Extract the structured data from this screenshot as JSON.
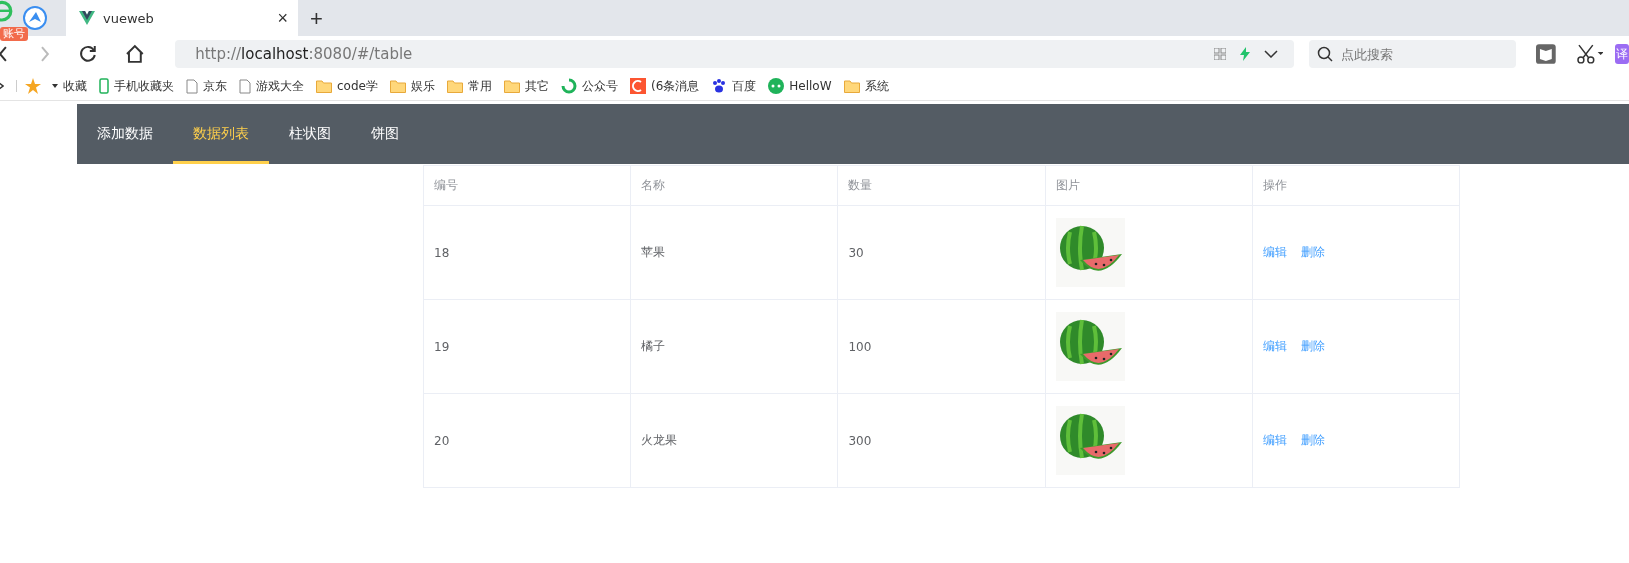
{
  "browser": {
    "badge": "账号",
    "tab": {
      "title": "vueweb",
      "close": "×"
    },
    "new_tab": "+",
    "address": "http://**localhost**:8080/#/table",
    "search": {
      "placeholder": "点此搜索"
    },
    "translate": "译"
  },
  "bookmarks": [
    {
      "label": "收藏",
      "kind": "star"
    },
    {
      "label": "手机收藏夹",
      "kind": "phone"
    },
    {
      "label": "京东",
      "kind": "page"
    },
    {
      "label": "游戏大全",
      "kind": "page"
    },
    {
      "label": "code学",
      "kind": "folder"
    },
    {
      "label": "娱乐",
      "kind": "folder"
    },
    {
      "label": "常用",
      "kind": "folder"
    },
    {
      "label": "其它",
      "kind": "folder"
    },
    {
      "label": "公众号",
      "kind": "swirl"
    },
    {
      "label": "(6条消息",
      "kind": "c"
    },
    {
      "label": "百度",
      "kind": "paw"
    },
    {
      "label": "HelloW",
      "kind": "chat"
    },
    {
      "label": "系统",
      "kind": "folder"
    }
  ],
  "nav": [
    {
      "label": "添加数据",
      "selected": false
    },
    {
      "label": "数据列表",
      "selected": true
    },
    {
      "label": "柱状图",
      "selected": false
    },
    {
      "label": "饼图",
      "selected": false
    }
  ],
  "table": {
    "columns": [
      "编号",
      "名称",
      "数量",
      "图片",
      "操作"
    ],
    "rows": [
      {
        "id": "18",
        "name": "苹果",
        "count": "30",
        "image": {
          "kind": "picture"
        },
        "actions": [
          "编辑",
          "删除"
        ]
      },
      {
        "id": "19",
        "name": "橘子",
        "count": "100",
        "image": {
          "kind": "picture"
        },
        "actions": [
          "编辑",
          "删除"
        ]
      },
      {
        "id": "20",
        "name": "火龙果",
        "count": "300",
        "image": {
          "kind": "picture"
        },
        "actions": [
          "编辑",
          "删除"
        ]
      }
    ]
  }
}
